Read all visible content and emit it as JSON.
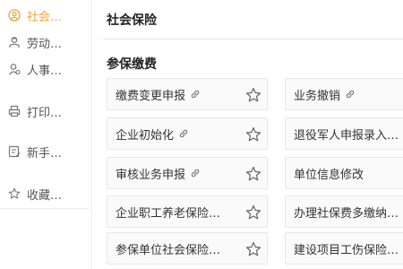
{
  "sidebar": {
    "items": [
      {
        "label": "社会…",
        "icon": "social-icon",
        "active": true
      },
      {
        "label": "劳动…",
        "icon": "worker-icon",
        "active": false
      },
      {
        "label": "人事…",
        "icon": "person-icon",
        "active": false
      },
      {
        "label": "打印…",
        "icon": "printer-icon",
        "active": false
      },
      {
        "label": "新手…",
        "icon": "guide-icon",
        "active": false
      },
      {
        "label": "收藏…",
        "icon": "star-icon",
        "active": false
      }
    ]
  },
  "main": {
    "title": "社会保险",
    "section_title": "参保缴费",
    "cards": [
      {
        "label": "缴费变更申报",
        "link": true
      },
      {
        "label": "业务撤销",
        "link": true
      },
      {
        "label": "企业初始化",
        "link": true
      },
      {
        "label": "退役军人申报录入…",
        "link": false
      },
      {
        "label": "审核业务申报",
        "link": true
      },
      {
        "label": "单位信息修改",
        "link": false
      },
      {
        "label": "企业职工养老保险…",
        "link": false
      },
      {
        "label": "办理社保费多缴纳…",
        "link": false
      },
      {
        "label": "参保单位社会保险…",
        "link": false
      },
      {
        "label": "建设项目工伤保险…",
        "link": false
      }
    ]
  },
  "colors": {
    "accent": "#f0a43a",
    "text": "#333333",
    "border": "#e8e8e8"
  }
}
